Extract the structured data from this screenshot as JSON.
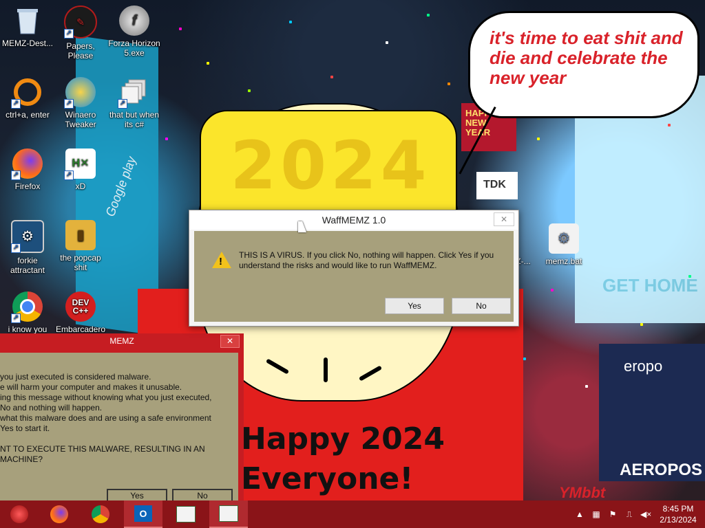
{
  "wallpaper": {
    "bubble_text": "it's time to eat shit and die and celebrate the new year",
    "hat_year": "2024",
    "shirt_line1": "Happy 2024",
    "shirt_line2": "Everyone!",
    "billboard_google": "Google play",
    "billboard_tdk": "TDK",
    "billboard_gethome": "GET HOME",
    "billboard_happy": "HAPPY NEW YEAR",
    "billboard_aero": "AEROPOS",
    "billboard_europ": "eropo",
    "signature": "YMbbt"
  },
  "desktop_icons": [
    {
      "label": "MEMZ-Dest...",
      "icon": "recycle-bin-icon"
    },
    {
      "label": "Papers, Please",
      "icon": "papers-please-icon"
    },
    {
      "label": "Forza Horizon 5.exe",
      "icon": "flash-icon"
    },
    {
      "label": "ctrl+a, enter",
      "icon": "ring-icon"
    },
    {
      "label": "Winaero Tweaker",
      "icon": "winaero-icon"
    },
    {
      "label": "that but when its c#",
      "icon": "windows-stack-icon"
    },
    {
      "label": "Firefox",
      "icon": "firefox-icon"
    },
    {
      "label": "xD",
      "icon": "hxd-icon"
    },
    {
      "label": "forkie attractant",
      "icon": "settings-monitor-icon"
    },
    {
      "label": "the popcap shit",
      "icon": "folder-icon"
    },
    {
      "label": "i know you",
      "icon": "chrome-icon"
    },
    {
      "label": "Embarcadero",
      "icon": "devcpp-icon"
    },
    {
      "label": "Z-...",
      "icon": "z-icon"
    },
    {
      "label": "memz.bat",
      "icon": "batch-gear-icon"
    }
  ],
  "dialog_main": {
    "title": "WaffMEMZ 1.0",
    "close": "✕",
    "message": "THIS IS A VIRUS. If you click No, nothing will happen. Click Yes if you understand the risks and would like to run WaffMEMZ.",
    "yes": "Yes",
    "no": "No"
  },
  "dialog_red": {
    "title": "MEMZ",
    "close": "✕",
    "message": "you just executed is considered malware.\ne will harm your computer and makes it unusable.\ning this message without knowing what you just executed,\nNo and nothing will happen.\nwhat this malware does and are using a safe environment\nYes to start it.\n\nNT TO EXECUTE THIS MALWARE, RESULTING IN AN\nMACHINE?",
    "yes": "Yes",
    "no": "No"
  },
  "taskbar": {
    "items": [
      {
        "name": "start-button",
        "icon": "start-orb-icon",
        "active": false
      },
      {
        "name": "firefox",
        "icon": "firefox-icon",
        "active": false
      },
      {
        "name": "chrome",
        "icon": "chrome-icon",
        "active": false
      },
      {
        "name": "outlook",
        "icon": "outlook-icon",
        "active": true
      },
      {
        "name": "window-1",
        "icon": "app-window-icon",
        "active": false
      },
      {
        "name": "window-2",
        "icon": "app-window-icon",
        "active": true
      }
    ],
    "time": "8:45 PM",
    "date": "2/13/2024",
    "tray_icons": [
      "chevron-up-icon",
      "network-share-icon",
      "flag-icon",
      "network-icon",
      "volume-muted-icon"
    ]
  }
}
